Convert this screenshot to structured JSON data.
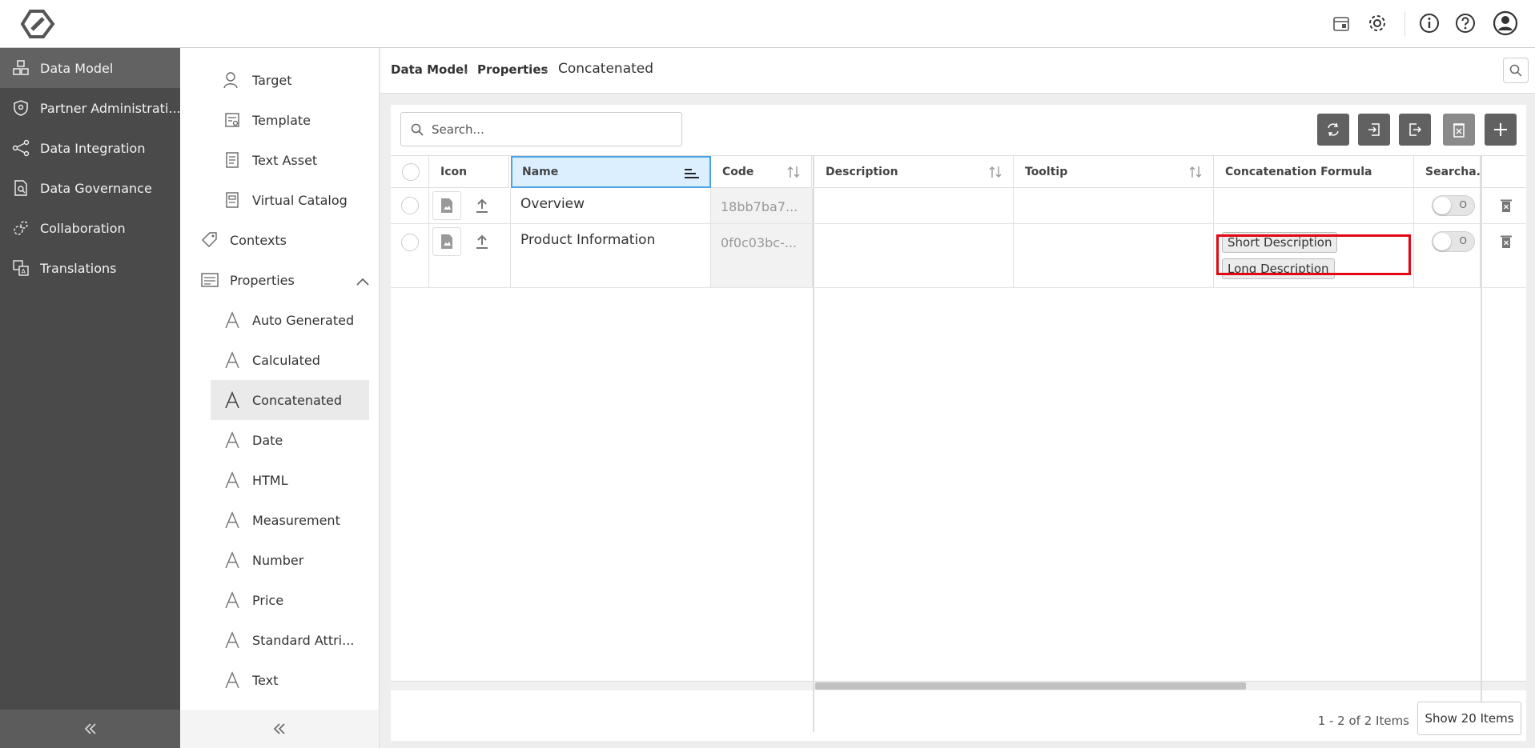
{
  "app": {
    "logo": "app-logo"
  },
  "topbar": {
    "icons": [
      "calendar-icon",
      "gear-icon",
      "info-icon",
      "help-icon",
      "user-icon"
    ]
  },
  "leftnav": {
    "items": [
      {
        "label": "Data Model",
        "icon": "cubes-icon",
        "active": true
      },
      {
        "label": "Partner Administrati...",
        "icon": "shield-icon"
      },
      {
        "label": "Data Integration",
        "icon": "share-icon"
      },
      {
        "label": "Data Governance",
        "icon": "document-search-icon"
      },
      {
        "label": "Collaboration",
        "icon": "gears-icon"
      },
      {
        "label": "Translations",
        "icon": "translate-icon"
      }
    ]
  },
  "submenu": {
    "items": [
      {
        "label": "Target"
      },
      {
        "label": "Template"
      },
      {
        "label": "Text Asset"
      },
      {
        "label": "Virtual Catalog"
      },
      {
        "label": "Contexts"
      },
      {
        "label": "Properties"
      },
      {
        "label": "Auto Generated"
      },
      {
        "label": "Calculated"
      },
      {
        "label": "Concatenated"
      },
      {
        "label": "Date"
      },
      {
        "label": "HTML"
      },
      {
        "label": "Measurement"
      },
      {
        "label": "Number"
      },
      {
        "label": "Price"
      },
      {
        "label": "Standard Attri..."
      },
      {
        "label": "Text"
      }
    ]
  },
  "breadcrumb": {
    "items": [
      "Data Model",
      "Properties"
    ],
    "current": "Concatenated",
    "sep": "›"
  },
  "search": {
    "placeholder": "Search..."
  },
  "grid": {
    "columns": [
      "Icon",
      "Name",
      "Code",
      "Description",
      "Tooltip",
      "Concatenation Formula",
      "Searcha.."
    ],
    "rows": [
      {
        "name": "Overview",
        "code": "18bb7ba7...",
        "description": "",
        "tooltip": "",
        "formula": [],
        "searchable": "O"
      },
      {
        "name": "Product Information",
        "code": "0f0c03bc-...",
        "description": "",
        "tooltip": "",
        "formula": [
          "Short Description",
          "Long Description"
        ],
        "searchable": "O"
      }
    ]
  },
  "footer": {
    "count": "1 - 2 of 2 Items",
    "page_size": "Show 20 Items"
  },
  "colors": {
    "nav_bg": "#4a4a4a",
    "nav_active": "#626262",
    "highlight": "#e30613",
    "selected_header": "#dcefff"
  }
}
